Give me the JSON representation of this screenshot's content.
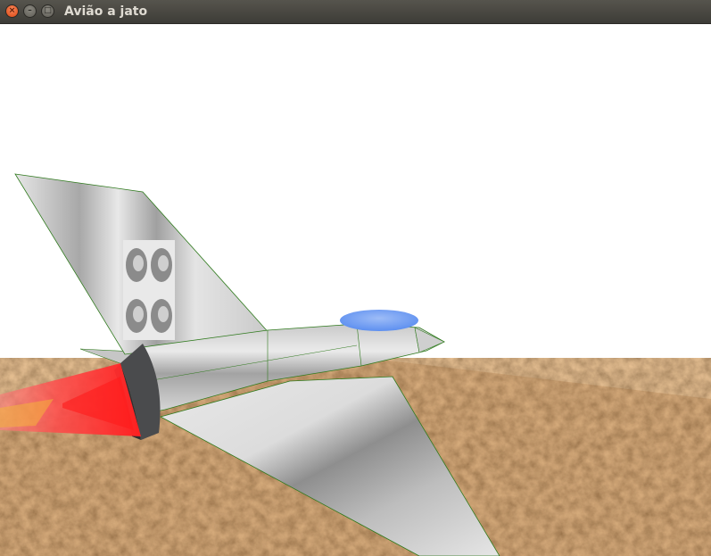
{
  "window": {
    "title": "Avião a jato",
    "buttons": {
      "close": "×",
      "minimize": "–",
      "maximize": "□"
    }
  },
  "scene": {
    "sky_color": "#ffffff",
    "ground_colors": [
      "#7a4a22",
      "#a9703f",
      "#5b3618",
      "#c48b55"
    ],
    "aircraft_body_color": "#d9d9d9",
    "canopy_color": "#6f9ff2",
    "wireframe_color": "#2f7a1d",
    "exhaust_color": "#ff2a2a",
    "engine_nozzle_color": "#4a4b4d"
  }
}
